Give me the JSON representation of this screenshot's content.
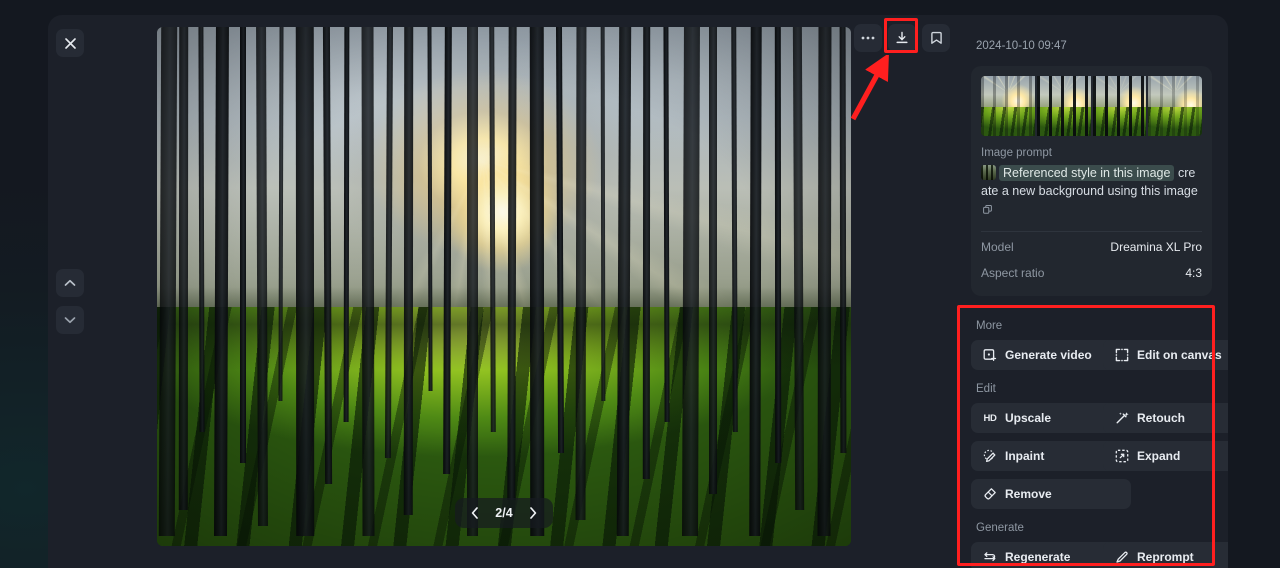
{
  "window": {
    "close_label": "×",
    "nav_up_label": "Previous item",
    "nav_down_label": "Next item"
  },
  "toolbar": {
    "more_label": "•••",
    "download_label": "Download",
    "bookmark_label": "Save to collection"
  },
  "viewer": {
    "pager": "2/4",
    "prev_label": "‹",
    "next_label": "›",
    "current_index": 2,
    "total": 4
  },
  "info": {
    "timestamp": "2024-10-10 09:47",
    "prompt_label": "Image prompt",
    "prompt_chip": "Referenced style in this image",
    "prompt_text": "create a new background using this image",
    "meta": [
      {
        "key": "Model",
        "value": "Dreamina XL Pro"
      },
      {
        "key": "Aspect ratio",
        "value": "4:3"
      }
    ]
  },
  "actions": {
    "sections": [
      {
        "title": "More",
        "buttons": [
          {
            "label": "Generate video",
            "icon": "video-frame-plus-icon"
          },
          {
            "label": "Edit on canvas",
            "icon": "crop-corners-icon"
          }
        ]
      },
      {
        "title": "Edit",
        "buttons": [
          {
            "label": "Upscale",
            "icon": "hd-icon"
          },
          {
            "label": "Retouch",
            "icon": "magic-wand-icon"
          },
          {
            "label": "Inpaint",
            "icon": "inpaint-brush-icon"
          },
          {
            "label": "Expand",
            "icon": "expand-frame-icon"
          },
          {
            "label": "Remove",
            "icon": "eraser-icon"
          }
        ]
      },
      {
        "title": "Generate",
        "buttons": [
          {
            "label": "Regenerate",
            "icon": "refresh-loop-icon"
          },
          {
            "label": "Reprompt",
            "icon": "pencil-icon"
          }
        ]
      }
    ]
  },
  "annotations": {
    "highlight_color": "#ff1f1f",
    "arrow_target": "download-button",
    "box_target": "actions-panel"
  }
}
